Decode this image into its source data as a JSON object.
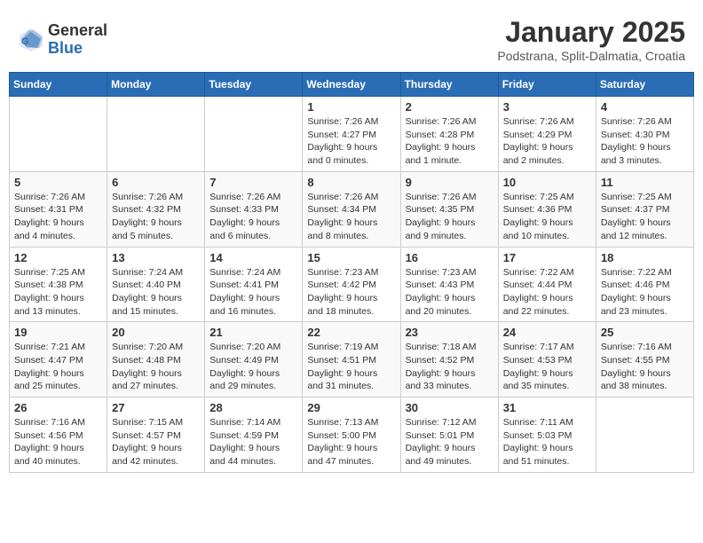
{
  "header": {
    "logo_general": "General",
    "logo_blue": "Blue",
    "month_title": "January 2025",
    "subtitle": "Podstrana, Split-Dalmatia, Croatia"
  },
  "days_of_week": [
    "Sunday",
    "Monday",
    "Tuesday",
    "Wednesday",
    "Thursday",
    "Friday",
    "Saturday"
  ],
  "weeks": [
    [
      {
        "day": "",
        "text": ""
      },
      {
        "day": "",
        "text": ""
      },
      {
        "day": "",
        "text": ""
      },
      {
        "day": "1",
        "text": "Sunrise: 7:26 AM\nSunset: 4:27 PM\nDaylight: 9 hours and 0 minutes."
      },
      {
        "day": "2",
        "text": "Sunrise: 7:26 AM\nSunset: 4:28 PM\nDaylight: 9 hours and 1 minute."
      },
      {
        "day": "3",
        "text": "Sunrise: 7:26 AM\nSunset: 4:29 PM\nDaylight: 9 hours and 2 minutes."
      },
      {
        "day": "4",
        "text": "Sunrise: 7:26 AM\nSunset: 4:30 PM\nDaylight: 9 hours and 3 minutes."
      }
    ],
    [
      {
        "day": "5",
        "text": "Sunrise: 7:26 AM\nSunset: 4:31 PM\nDaylight: 9 hours and 4 minutes."
      },
      {
        "day": "6",
        "text": "Sunrise: 7:26 AM\nSunset: 4:32 PM\nDaylight: 9 hours and 5 minutes."
      },
      {
        "day": "7",
        "text": "Sunrise: 7:26 AM\nSunset: 4:33 PM\nDaylight: 9 hours and 6 minutes."
      },
      {
        "day": "8",
        "text": "Sunrise: 7:26 AM\nSunset: 4:34 PM\nDaylight: 9 hours and 8 minutes."
      },
      {
        "day": "9",
        "text": "Sunrise: 7:26 AM\nSunset: 4:35 PM\nDaylight: 9 hours and 9 minutes."
      },
      {
        "day": "10",
        "text": "Sunrise: 7:25 AM\nSunset: 4:36 PM\nDaylight: 9 hours and 10 minutes."
      },
      {
        "day": "11",
        "text": "Sunrise: 7:25 AM\nSunset: 4:37 PM\nDaylight: 9 hours and 12 minutes."
      }
    ],
    [
      {
        "day": "12",
        "text": "Sunrise: 7:25 AM\nSunset: 4:38 PM\nDaylight: 9 hours and 13 minutes."
      },
      {
        "day": "13",
        "text": "Sunrise: 7:24 AM\nSunset: 4:40 PM\nDaylight: 9 hours and 15 minutes."
      },
      {
        "day": "14",
        "text": "Sunrise: 7:24 AM\nSunset: 4:41 PM\nDaylight: 9 hours and 16 minutes."
      },
      {
        "day": "15",
        "text": "Sunrise: 7:23 AM\nSunset: 4:42 PM\nDaylight: 9 hours and 18 minutes."
      },
      {
        "day": "16",
        "text": "Sunrise: 7:23 AM\nSunset: 4:43 PM\nDaylight: 9 hours and 20 minutes."
      },
      {
        "day": "17",
        "text": "Sunrise: 7:22 AM\nSunset: 4:44 PM\nDaylight: 9 hours and 22 minutes."
      },
      {
        "day": "18",
        "text": "Sunrise: 7:22 AM\nSunset: 4:46 PM\nDaylight: 9 hours and 23 minutes."
      }
    ],
    [
      {
        "day": "19",
        "text": "Sunrise: 7:21 AM\nSunset: 4:47 PM\nDaylight: 9 hours and 25 minutes."
      },
      {
        "day": "20",
        "text": "Sunrise: 7:20 AM\nSunset: 4:48 PM\nDaylight: 9 hours and 27 minutes."
      },
      {
        "day": "21",
        "text": "Sunrise: 7:20 AM\nSunset: 4:49 PM\nDaylight: 9 hours and 29 minutes."
      },
      {
        "day": "22",
        "text": "Sunrise: 7:19 AM\nSunset: 4:51 PM\nDaylight: 9 hours and 31 minutes."
      },
      {
        "day": "23",
        "text": "Sunrise: 7:18 AM\nSunset: 4:52 PM\nDaylight: 9 hours and 33 minutes."
      },
      {
        "day": "24",
        "text": "Sunrise: 7:17 AM\nSunset: 4:53 PM\nDaylight: 9 hours and 35 minutes."
      },
      {
        "day": "25",
        "text": "Sunrise: 7:16 AM\nSunset: 4:55 PM\nDaylight: 9 hours and 38 minutes."
      }
    ],
    [
      {
        "day": "26",
        "text": "Sunrise: 7:16 AM\nSunset: 4:56 PM\nDaylight: 9 hours and 40 minutes."
      },
      {
        "day": "27",
        "text": "Sunrise: 7:15 AM\nSunset: 4:57 PM\nDaylight: 9 hours and 42 minutes."
      },
      {
        "day": "28",
        "text": "Sunrise: 7:14 AM\nSunset: 4:59 PM\nDaylight: 9 hours and 44 minutes."
      },
      {
        "day": "29",
        "text": "Sunrise: 7:13 AM\nSunset: 5:00 PM\nDaylight: 9 hours and 47 minutes."
      },
      {
        "day": "30",
        "text": "Sunrise: 7:12 AM\nSunset: 5:01 PM\nDaylight: 9 hours and 49 minutes."
      },
      {
        "day": "31",
        "text": "Sunrise: 7:11 AM\nSunset: 5:03 PM\nDaylight: 9 hours and 51 minutes."
      },
      {
        "day": "",
        "text": ""
      }
    ]
  ]
}
